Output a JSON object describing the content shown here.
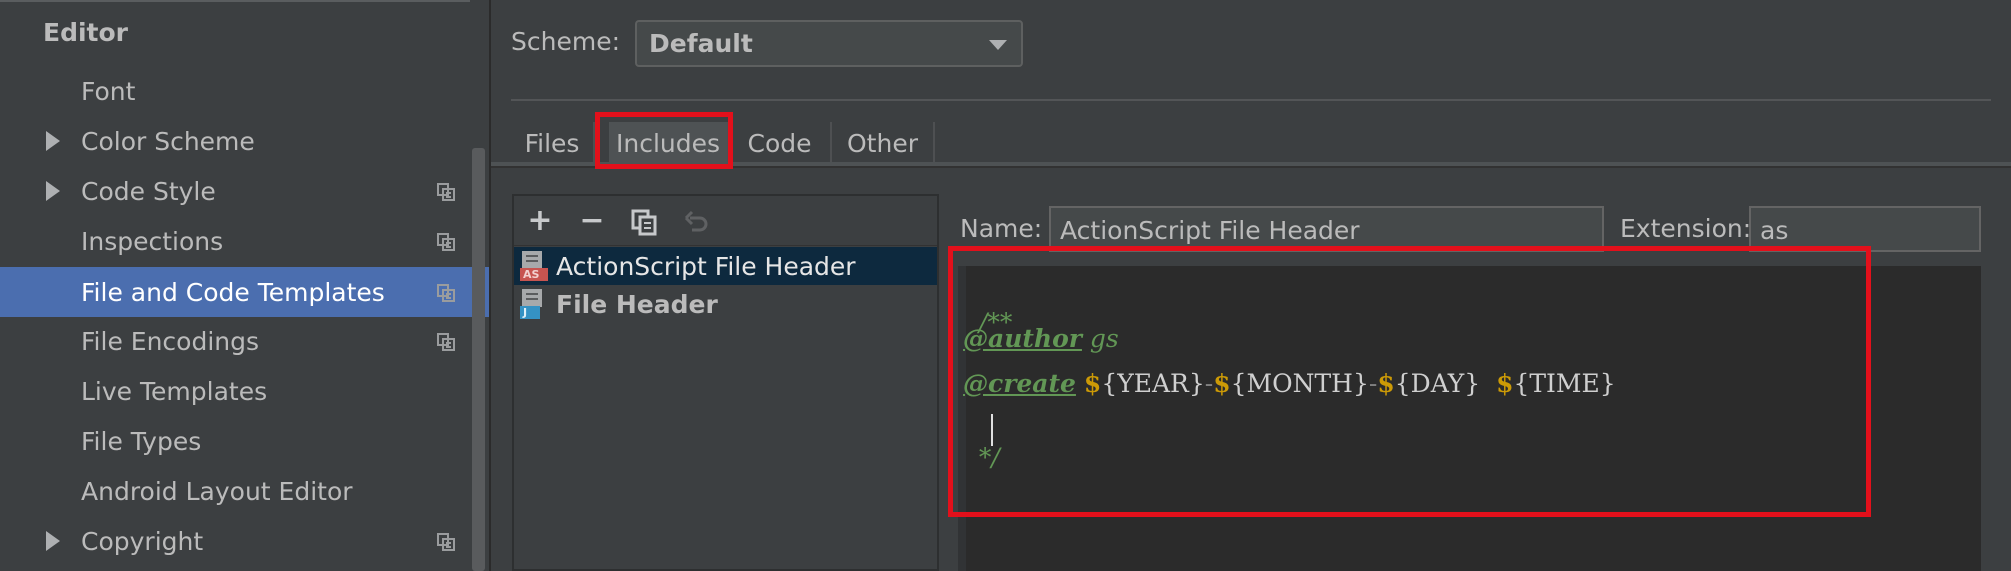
{
  "sidebar": {
    "header": "Editor",
    "items": [
      {
        "label": "Font",
        "expandable": false,
        "copy_icon": false,
        "selected": false
      },
      {
        "label": "Color Scheme",
        "expandable": true,
        "copy_icon": false,
        "selected": false
      },
      {
        "label": "Code Style",
        "expandable": true,
        "copy_icon": true,
        "selected": false
      },
      {
        "label": "Inspections",
        "expandable": false,
        "copy_icon": true,
        "selected": false
      },
      {
        "label": "File and Code Templates",
        "expandable": false,
        "copy_icon": true,
        "selected": true
      },
      {
        "label": "File Encodings",
        "expandable": false,
        "copy_icon": true,
        "selected": false
      },
      {
        "label": "Live Templates",
        "expandable": false,
        "copy_icon": false,
        "selected": false
      },
      {
        "label": "File Types",
        "expandable": false,
        "copy_icon": false,
        "selected": false
      },
      {
        "label": "Android Layout Editor",
        "expandable": false,
        "copy_icon": false,
        "selected": false
      },
      {
        "label": "Copyright",
        "expandable": true,
        "copy_icon": true,
        "selected": false
      }
    ]
  },
  "scheme": {
    "label": "Scheme:",
    "value": "Default"
  },
  "tabs": [
    {
      "label": "Files",
      "active": false
    },
    {
      "label": "Includes",
      "active": true
    },
    {
      "label": "Code",
      "active": false
    },
    {
      "label": "Other",
      "active": false
    }
  ],
  "toolbar": {
    "add": "+",
    "remove": "−",
    "copy_icon": "copy-icon",
    "reset_icon": "undo-icon"
  },
  "templates": [
    {
      "label": "ActionScript File Header",
      "icon_tag": "AS",
      "selected": true,
      "bold": false
    },
    {
      "label": "File Header",
      "icon_tag": "J",
      "selected": false,
      "bold": true
    }
  ],
  "name": {
    "label": "Name:",
    "value": "ActionScript File Header"
  },
  "extension": {
    "label": "Extension:",
    "value": "as"
  },
  "editor": {
    "line1": "/**",
    "line2_tag": "@author",
    "line2_value": "gs",
    "line3_tag": "@create",
    "line3_year": "${YEAR}",
    "line3_month": "${MONTH}",
    "line3_day": "${DAY}",
    "line3_time": "${TIME}",
    "line4": "*/"
  },
  "colors": {
    "accent_selection": "#4b6eaf",
    "annotation_red": "#e3101b",
    "comment_green": "#629755",
    "variable_gold": "#cc9a06"
  }
}
